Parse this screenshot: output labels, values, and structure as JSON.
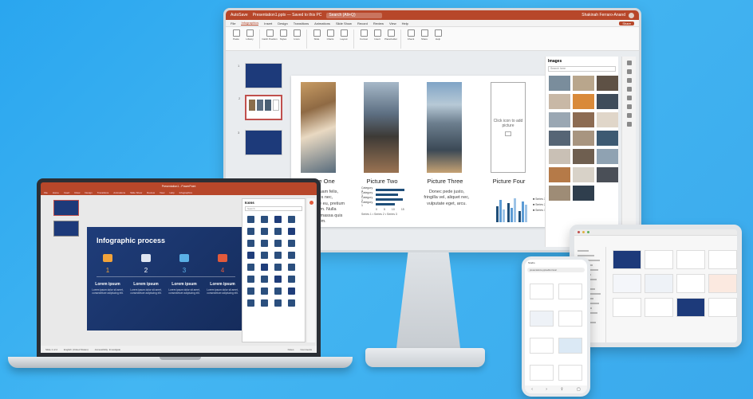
{
  "monitor": {
    "titlebar": {
      "autosave": "AutoSave",
      "doc_title": "Presentation1.pptx — Saved to this PC",
      "search_placeholder": "Search (Alt+Q)",
      "user": "Shakinah Ferraro-Anand"
    },
    "menu": [
      "File",
      "Infographics",
      "Insert",
      "Design",
      "Transitions",
      "Animations",
      "Slide Show",
      "Record",
      "Review",
      "View",
      "Help"
    ],
    "menu_active": "Infographics",
    "share_label": "Share",
    "ribbon": [
      "Paste",
      "Library",
      "Catch Position",
      "Styles",
      "Icons",
      "Slide",
      "Charts",
      "Layout",
      "Format",
      "Insert",
      "Placeholder",
      "Check",
      "Share",
      "Help"
    ],
    "slide": {
      "placeholder_text": "Click icon to add picture",
      "titles": [
        "Picture One",
        "Picture Two",
        "Picture Three",
        "Picture Four"
      ],
      "col1_text": "Donec quam felis, ultricies nec, pellentesque eu, pretium quis, sem. Nulla consequat massa quis enim.",
      "col3_text": "Donec pede justo, fringilla vel, aliquet nec, vulputate eget, arcu.",
      "bar_rows": [
        "Category 4",
        "Category 3",
        "Category 2",
        "Category 1"
      ],
      "bar_values": [
        0.9,
        0.7,
        0.85,
        0.6
      ],
      "bar_axis": [
        "0",
        "5",
        "10",
        "15"
      ],
      "bar_legend": "Series 1 • Series 2 • Series 3",
      "col_legend": [
        "Series 3",
        "Series 2",
        "Series 1"
      ]
    },
    "panel": {
      "title": "Images",
      "search": "Search here"
    }
  },
  "laptop": {
    "title": "Presentation1 - PowerPoint",
    "menu": [
      "File",
      "Home",
      "Insert",
      "Draw",
      "Design",
      "Transitions",
      "Animations",
      "Slide Show",
      "Review",
      "View",
      "Help",
      "Infographics"
    ],
    "slide_title": "Infographic process",
    "steps": [
      {
        "num": "1",
        "title": "Lorem ipsum",
        "desc": "Lorem ipsum dolor sit amet, consectetuer adipiscing elit."
      },
      {
        "num": "2",
        "title": "Lorem ipsum",
        "desc": "Lorem ipsum dolor sit amet, consectetuer adipiscing elit."
      },
      {
        "num": "3",
        "title": "Lorem ipsum",
        "desc": "Lorem ipsum dolor sit amet, consectetuer adipiscing elit."
      },
      {
        "num": "4",
        "title": "Lorem ipsum",
        "desc": "Lorem ipsum dolor sit amet, consectetuer adipiscing elit."
      }
    ],
    "panel": {
      "title": "Icons",
      "search": "Search"
    },
    "status": [
      "Slide 1 of 2",
      "English (United States)",
      "Accessibility: Investigate",
      "Notes",
      "Comments"
    ]
  },
  "phone": {
    "app": "Studio",
    "url": "presentations.pptxeditor.local"
  },
  "colors": {
    "accent": "#b7472a",
    "slide_navy": "#1f3d7a",
    "background": "#3aa9ec"
  }
}
